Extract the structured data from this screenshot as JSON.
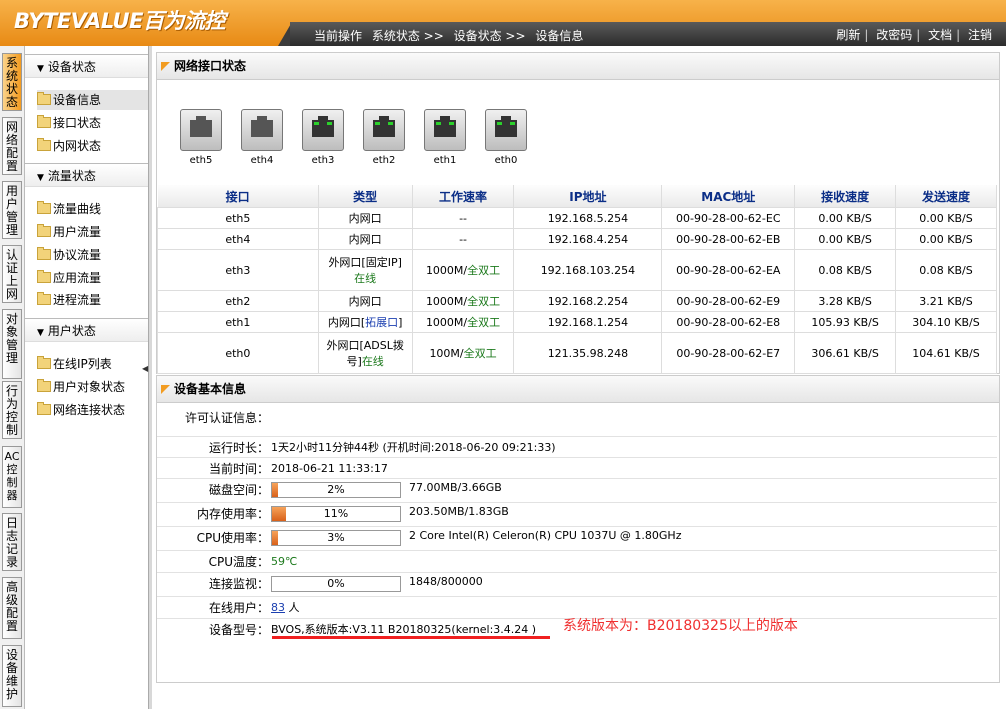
{
  "brand": {
    "logo_text": "BYTEVALUE百为流控"
  },
  "header": {
    "breadcrumb": [
      "当前操作",
      "系统状态 >>",
      "设备状态 >>",
      "设备信息"
    ],
    "links": [
      "刷新",
      "改密码",
      "文档",
      "注销"
    ]
  },
  "left_tabs": [
    "系统状态",
    "网络配置",
    "用户管理",
    "认证上网",
    "对象管理",
    "行为控制",
    "AC控制器",
    "日志记录",
    "高级配置",
    "设备维护"
  ],
  "menu": {
    "groups": [
      {
        "title": "设备状态",
        "items": [
          "设备信息",
          "接口状态",
          "内网状态"
        ]
      },
      {
        "title": "流量状态",
        "items": [
          "流量曲线",
          "用户流量",
          "协议流量",
          "应用流量",
          "进程流量"
        ]
      },
      {
        "title": "用户状态",
        "items": [
          "在线IP列表",
          "用户对象状态",
          "网络连接状态"
        ]
      }
    ]
  },
  "network": {
    "title": "网络接口状态",
    "ports": [
      {
        "name": "eth5",
        "up": false
      },
      {
        "name": "eth4",
        "up": false
      },
      {
        "name": "eth3",
        "up": true
      },
      {
        "name": "eth2",
        "up": true
      },
      {
        "name": "eth1",
        "up": true
      },
      {
        "name": "eth0",
        "up": true
      }
    ],
    "columns": [
      "接口",
      "类型",
      "工作速率",
      "IP地址",
      "MAC地址",
      "接收速度",
      "发送速度"
    ],
    "rows": [
      {
        "iface": "eth5",
        "type": "内网口",
        "type_extra": "",
        "speed": "--",
        "speed_extra": "",
        "ip": "192.168.5.254",
        "mac": "00-90-28-00-62-EC",
        "rx": "0.00 KB/S",
        "tx": "0.00 KB/S"
      },
      {
        "iface": "eth4",
        "type": "内网口",
        "type_extra": "",
        "speed": "--",
        "speed_extra": "",
        "ip": "192.168.4.254",
        "mac": "00-90-28-00-62-EB",
        "rx": "0.00 KB/S",
        "tx": "0.00 KB/S"
      },
      {
        "iface": "eth3",
        "type": "外网口[固定IP]",
        "type_extra": "在线",
        "speed": "1000M/",
        "speed_extra": "全双工",
        "ip": "192.168.103.254",
        "mac": "00-90-28-00-62-EA",
        "rx": "0.08 KB/S",
        "tx": "0.08 KB/S"
      },
      {
        "iface": "eth2",
        "type": "内网口",
        "type_extra": "",
        "speed": "1000M/",
        "speed_extra": "全双工",
        "ip": "192.168.2.254",
        "mac": "00-90-28-00-62-E9",
        "rx": "3.28 KB/S",
        "tx": "3.21 KB/S"
      },
      {
        "iface": "eth1",
        "type": "内网口[",
        "type_extra": "拓展口",
        "type_close": "]",
        "speed": "1000M/",
        "speed_extra": "全双工",
        "ip": "192.168.1.254",
        "mac": "00-90-28-00-62-E8",
        "rx": "105.93 KB/S",
        "tx": "304.10 KB/S"
      },
      {
        "iface": "eth0",
        "type": "外网口[ADSL拨号]",
        "type_extra": "在线",
        "speed": "100M/",
        "speed_extra": "全双工",
        "ip": "121.35.98.248",
        "mac": "00-90-28-00-62-E7",
        "rx": "306.61 KB/S",
        "tx": "104.61 KB/S"
      }
    ]
  },
  "device": {
    "title": "设备基本信息",
    "license_label": "许可认证信息：",
    "uptime_label": "运行时长：",
    "uptime": "1天2小时11分钟44秒 (开机时间:2018-06-20 09:21:33)",
    "time_label": "当前时间：",
    "time": "2018-06-21 11:33:17",
    "disk_label": "磁盘空间：",
    "disk_pct": "2%",
    "disk_frac": 0.02,
    "disk_aux": "77.00MB/3.66GB",
    "mem_label": "内存使用率：",
    "mem_pct": "11%",
    "mem_frac": 0.11,
    "mem_aux": "203.50MB/1.83GB",
    "cpu_label": "CPU使用率：",
    "cpu_pct": "3%",
    "cpu_frac": 0.03,
    "cpu_aux": "2 Core Intel(R) Celeron(R) CPU 1037U @ 1.80GHz",
    "temp_label": "CPU温度：",
    "temp": "59℃",
    "conn_label": "连接监视：",
    "conn_pct": "0%",
    "conn_frac": 0.0,
    "conn_aux": "1848/800000",
    "online_label": "在线用户：",
    "online_count": "83",
    "online_unit": "人",
    "model_label": "设备型号：",
    "model": "BVOS,系统版本:V3.11 B20180325(kernel:3.4.24 )"
  },
  "annotation": "系统版本为：B20180325以上的版本",
  "colors": {
    "accent": "#f29c21",
    "header_link": "#0b2e87",
    "ok": "#1d7a1d",
    "annotation": "#f03030"
  }
}
